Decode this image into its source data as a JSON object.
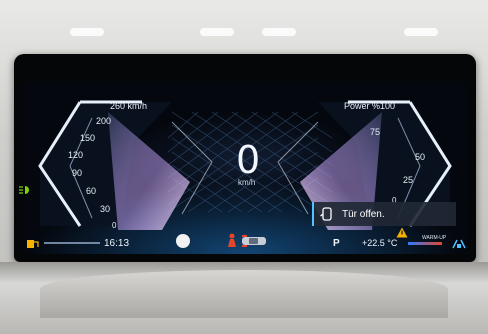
{
  "speed": {
    "value": "0",
    "unit": "km/h"
  },
  "speed_scale": {
    "max_label": "260 km/h",
    "ticks": [
      "200",
      "150",
      "120",
      "90",
      "60",
      "30",
      "0"
    ]
  },
  "power_scale": {
    "label": "Power %",
    "max": "100",
    "ticks": [
      "75",
      "50",
      "25",
      "0"
    ]
  },
  "notification": {
    "text": "Tür offen."
  },
  "status_bar": {
    "time": "16:13",
    "gear": "P",
    "temperature": "+22.5 °C",
    "warm_up_label": "WARM-UP"
  },
  "colors": {
    "accent": "#4fc3ff",
    "warning": "#f5b300",
    "headlight": "#7bd400",
    "door_alert": "#e5452d"
  },
  "icons": [
    "headlight-icon",
    "fuel-icon",
    "door-open-icon",
    "car-top-view-icon",
    "warning-triangle-icon",
    "lane-assist-icon"
  ]
}
